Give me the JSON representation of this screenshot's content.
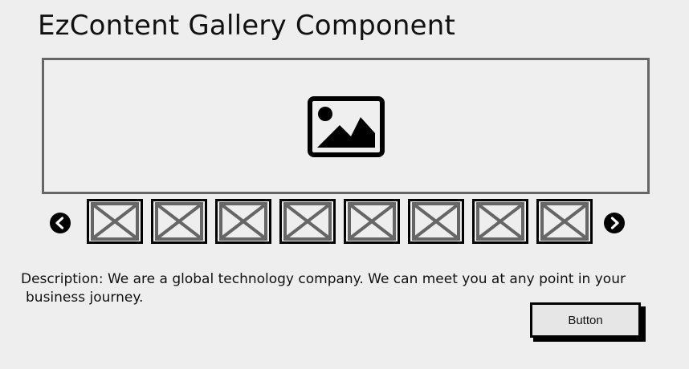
{
  "page": {
    "title": "EzContent Gallery Component"
  },
  "gallery": {
    "main_image_icon": "image-icon",
    "prev_icon": "chevron-left-icon",
    "next_icon": "chevron-right-icon",
    "thumbnails": [
      {
        "icon": "image-placeholder-x"
      },
      {
        "icon": "image-placeholder-x"
      },
      {
        "icon": "image-placeholder-x"
      },
      {
        "icon": "image-placeholder-x"
      },
      {
        "icon": "image-placeholder-x"
      },
      {
        "icon": "image-placeholder-x"
      },
      {
        "icon": "image-placeholder-x"
      },
      {
        "icon": "image-placeholder-x"
      }
    ]
  },
  "description": {
    "line1": "Description: We are a global technology company. We can meet you at any point in your",
    "line2": "business journey."
  },
  "button": {
    "label": "Button"
  }
}
